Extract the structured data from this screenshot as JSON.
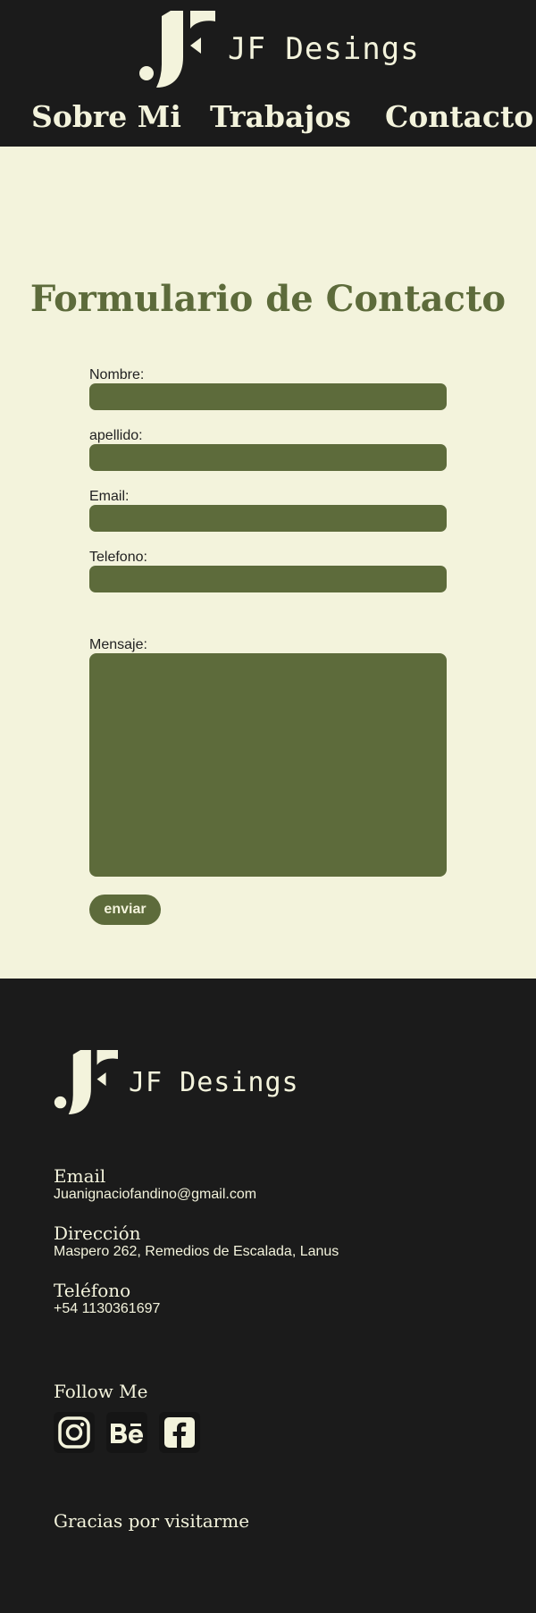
{
  "brand": {
    "name": "JF Desings"
  },
  "nav": {
    "items": [
      "Sobre Mi",
      "Trabajos",
      "Contacto"
    ]
  },
  "form": {
    "title": "Formulario de Contacto",
    "labels": [
      "Nombre:",
      "apellido:",
      "Email:",
      "Telefono:",
      "Mensaje:"
    ],
    "submit_label": "enviar"
  },
  "footer": {
    "brand_name": "JF Desings",
    "email_label": "Email",
    "email_value": "Juanignaciofandino@gmail.com",
    "address_label": "Dirección",
    "address_value": "Maspero 262, Remedios de Escalada, Lanus",
    "phone_label": "Teléfono",
    "phone_value": "+54 1130361697",
    "follow_label": "Follow Me",
    "social_icons": [
      "instagram-icon",
      "behance-icon",
      "facebook-icon"
    ],
    "thanks": "Gracias por visitarme"
  },
  "colors": {
    "dark": "#1b1b1b",
    "cream": "#f3f3dc",
    "olive": "#5d6b3b"
  }
}
